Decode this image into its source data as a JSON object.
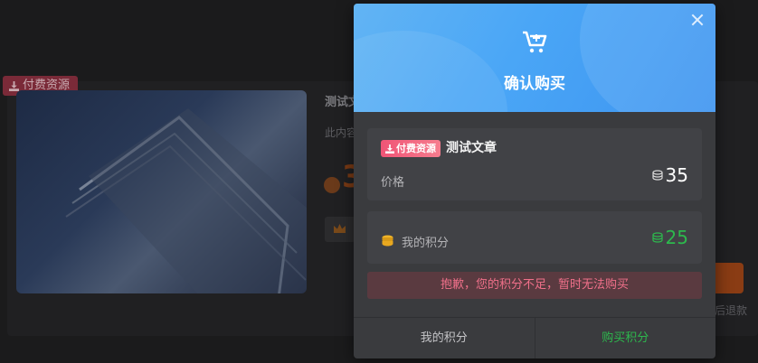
{
  "background": {
    "paid_tag": "付费资源",
    "title": "测试文",
    "desc": "此内容",
    "price_digit": "3",
    "refund_fragment": "后退款"
  },
  "modal": {
    "title": "确认购买",
    "article": {
      "tag": "付费资源",
      "name": "测试文章"
    },
    "price_label": "价格",
    "price_value": "35",
    "points_label": "我的积分",
    "points_value": "25",
    "warning": "抱歉，您的积分不足，暂时无法购买",
    "footer": {
      "my_points": "我的积分",
      "buy_points": "购买积分"
    }
  },
  "colors": {
    "header_blue": "#4aa6f6",
    "accent_green": "#2db84d",
    "warning_red": "#f0708a",
    "tag_pink": "#f05576"
  },
  "icons": [
    "cart-icon",
    "close-icon",
    "download-icon",
    "coin-icon"
  ]
}
